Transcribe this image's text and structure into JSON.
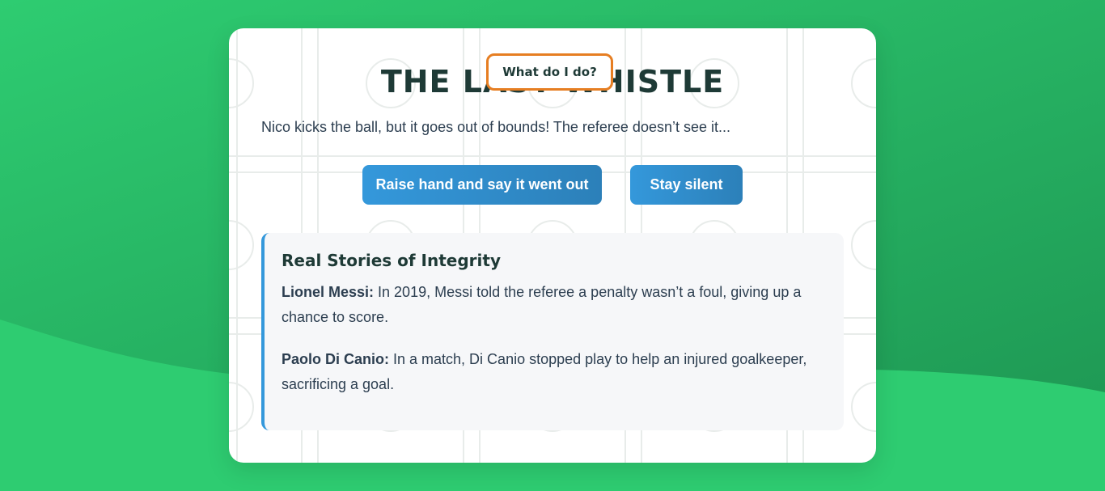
{
  "page": {
    "title": "THE LAST WHISTLE",
    "tooltip": "What do I do?",
    "scenario": "Nico kicks the ball, but it goes out of bounds! The referee doesn’t see it..."
  },
  "choices": {
    "raise_label": "Raise hand and say it went out",
    "silent_label": "Stay silent"
  },
  "stories": {
    "heading": "Real Stories of Integrity",
    "items": [
      {
        "name": "Lionel Messi:",
        "text": " In 2019, Messi told the referee a penalty wasn’t a foul, giving up a chance to score."
      },
      {
        "name": "Paolo Di Canio:",
        "text": " In a match, Di Canio stopped play to help an injured goalkeeper, sacrificing a goal."
      }
    ]
  },
  "colors": {
    "background": "#2ecc71",
    "accent_blue": "#3498db",
    "tooltip_border": "#e67e22",
    "heading": "#1e3a36"
  }
}
